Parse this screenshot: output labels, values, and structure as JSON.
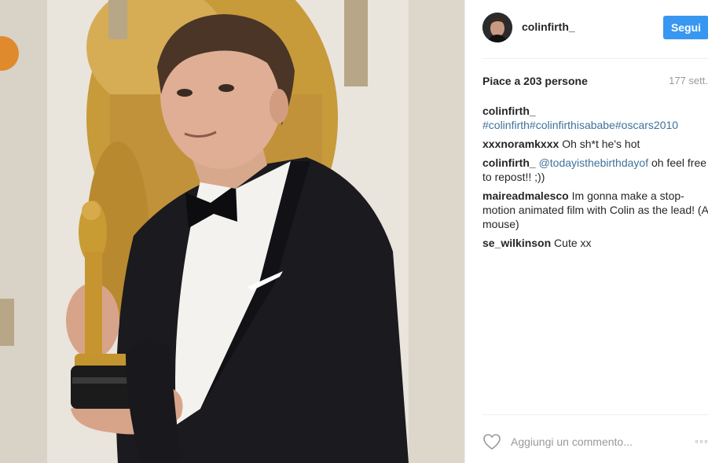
{
  "post": {
    "image_alt": "Colin Firth holding an Oscar statuette"
  },
  "header": {
    "username": "colinfirth_",
    "follow_label": "Segui"
  },
  "meta": {
    "likes": "Piace a 203 persone",
    "time": "177 sett."
  },
  "comments": [
    {
      "user": "colinfirth_",
      "parts": [
        "#colinfirth",
        "#colinfirthisababe",
        "#oscars2010"
      ]
    },
    {
      "user": "xxxnoramkxxx",
      "text": "Oh sh*t he's hot"
    },
    {
      "user": "colinfirth_",
      "mention": "@todayisthebirthdayof",
      "text": "oh feel free to repost!! ;))"
    },
    {
      "user": "maireadmalesco",
      "text": "Im gonna make a stop-motion animated film with Colin as the lead! (A mouse)"
    },
    {
      "user": "se_wilkinson",
      "text": "Cute xx"
    }
  ],
  "footer": {
    "comment_placeholder": "Aggiungi un commento...",
    "more": "◦◦◦"
  },
  "icons": {
    "like": "heart-icon",
    "more": "more-options-icon"
  },
  "colors": {
    "follow_button": "#3897f0",
    "link": "#3f729b",
    "muted": "#999999"
  }
}
